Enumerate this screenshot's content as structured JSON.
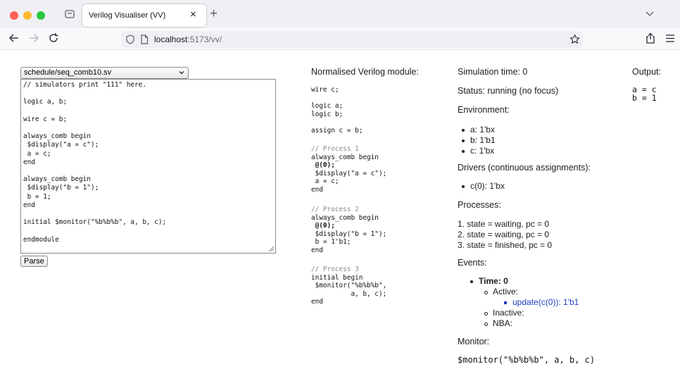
{
  "browser": {
    "tab_title": "Verilog Visualiser (VV)",
    "tab_close": "×",
    "new_tab": "+",
    "url_host": "localhost",
    "url_path": ":5173/vv/"
  },
  "editor": {
    "selected_file": "schedule/seq_comb10.sv",
    "source": "// simulators print \"111\" here.\n\nlogic a, b;\n\nwire c = b;\n\nalways_comb begin\n $display(\"a = c\");\n a = c;\nend\n\nalways_comb begin\n $display(\"b = 1\");\n b = 1;\nend\n\ninitial $monitor(\"%b%b%b\", a, b, c);\n\nendmodule",
    "parse_label": "Parse"
  },
  "normalised": {
    "heading": "Normalised Verilog module:",
    "decl": "wire c;\n\nlogic a;\nlogic b;\n\nassign c = b;",
    "processes": [
      {
        "comment": "// Process 1",
        "line1": "always_comb begin",
        "trigger": " @(0);",
        "rest": " $display(\"a = c\");\n a = c;\nend"
      },
      {
        "comment": "// Process 2",
        "line1": "always_comb begin",
        "trigger": " @(0);",
        "rest": " $display(\"b = 1\");\n b = 1'b1;\nend"
      },
      {
        "comment": "// Process 3",
        "body": "initial begin\n $monitor(\"%b%b%b\",\n          a, b, c);\nend"
      }
    ]
  },
  "simulation": {
    "time_text": "Simulation time: 0",
    "status_text": "Status: running (no focus)",
    "environment_heading": "Environment:",
    "environment": [
      "a: 1'bx",
      "b: 1'b1",
      "c: 1'bx"
    ],
    "drivers_heading": "Drivers (continuous assignments):",
    "drivers": [
      "c(0): 1'bx"
    ],
    "processes_heading": "Processes:",
    "processes": [
      "1. state = waiting, pc = 0",
      "2. state = waiting, pc = 0",
      "3. state = finished, pc = 0"
    ],
    "events_heading": "Events:",
    "events": {
      "time_label": "Time: 0",
      "active_label": "Active:",
      "active_items": [
        "update(c(0)): 1'b1"
      ],
      "inactive_label": "Inactive:",
      "nba_label": "NBA:"
    },
    "monitor_heading": "Monitor:",
    "monitor_value": "$monitor(\"%b%b%b\", a, b, c)"
  },
  "output": {
    "heading": "Output:",
    "text": "a = c\nb = 1"
  },
  "colors": {
    "event_active_item": "#2040c0"
  }
}
